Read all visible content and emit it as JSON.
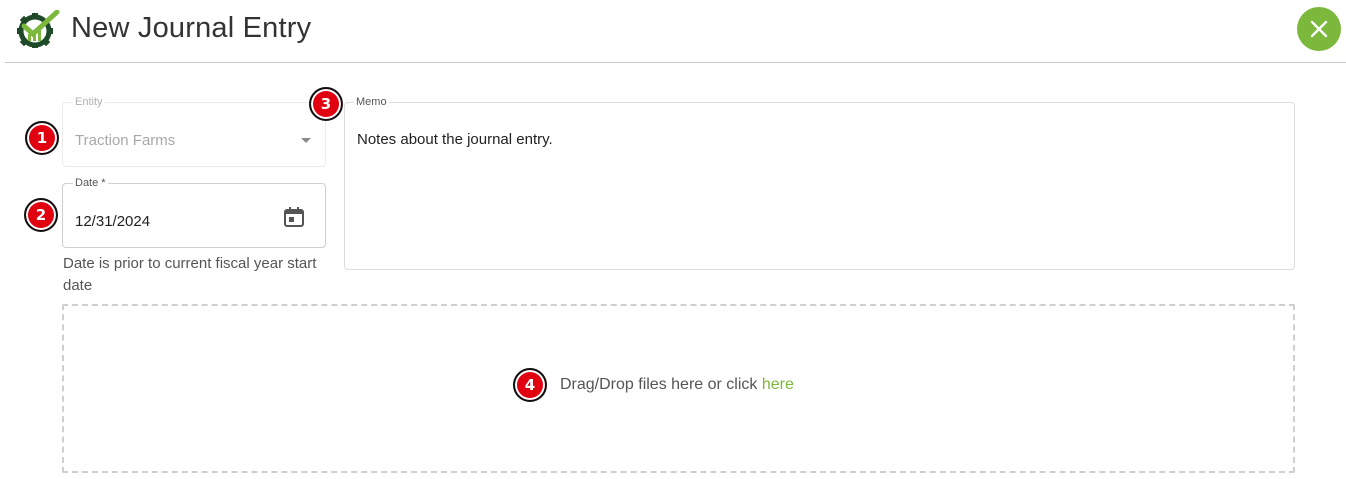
{
  "header": {
    "title": "New Journal Entry",
    "logo_icon": "gear-checkmark-logo",
    "close_icon": "close-icon",
    "accent_color": "#7cb83b"
  },
  "entity": {
    "label": "Entity",
    "value": "Traction Farms"
  },
  "date": {
    "label": "Date *",
    "value": "12/31/2024",
    "helper": "Date is prior to current fiscal year start date"
  },
  "memo": {
    "label": "Memo",
    "value": "Notes about the journal entry."
  },
  "dropzone": {
    "text": "Drag/Drop files here or click ",
    "link": "here"
  },
  "annotations": [
    "1",
    "2",
    "3",
    "4"
  ],
  "annotation_color": "#e0000f"
}
